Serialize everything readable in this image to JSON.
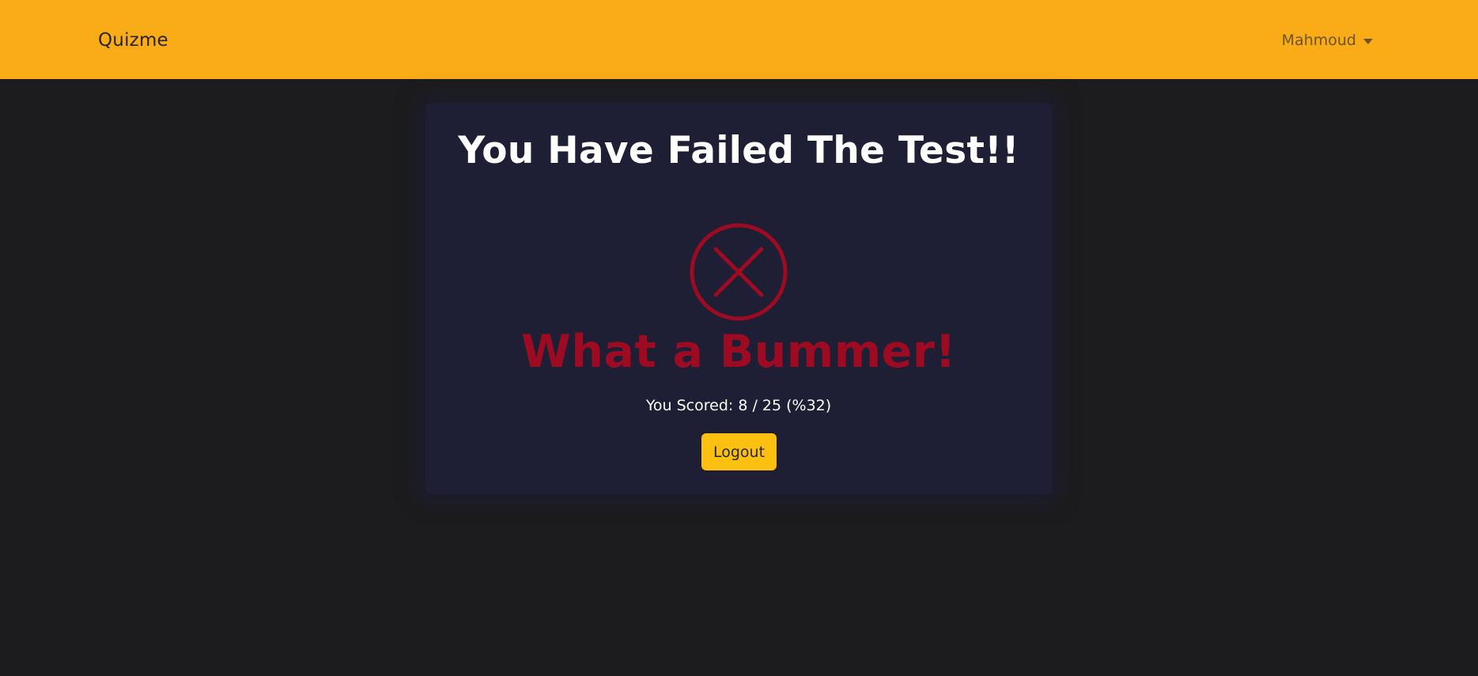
{
  "navbar": {
    "brand": "Quizme",
    "user_name": "Mahmoud"
  },
  "result": {
    "title": "You Have Failed The Test!!",
    "icon": "x-circle-icon",
    "headline": "What a Bummer!",
    "score_text": "You Scored: 8 / 25 (%32)",
    "score": 8,
    "total": 25,
    "percent": 32,
    "logout_label": "Logout"
  },
  "colors": {
    "navbar_bg": "#f9ab18",
    "page_bg": "#1c1c1e",
    "card_bg": "#1e1e34",
    "fail_red": "#9d0b22",
    "button_bg": "#fcc010"
  }
}
